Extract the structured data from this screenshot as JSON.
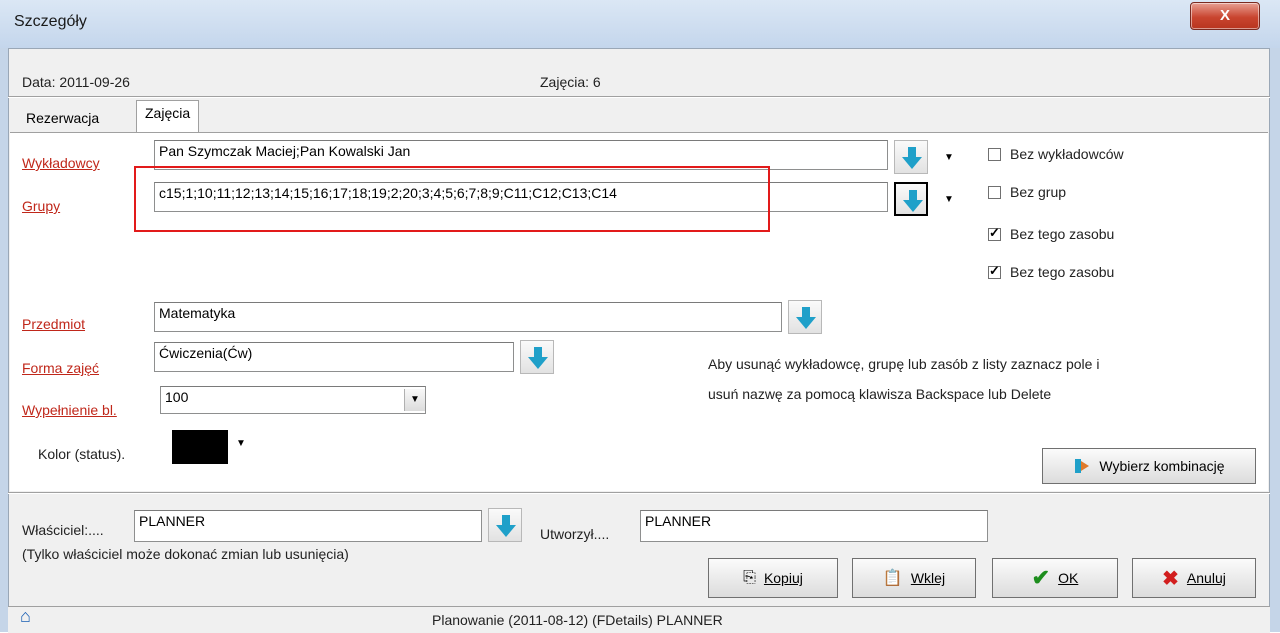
{
  "window": {
    "title": "Szczegóły",
    "close_label": "X"
  },
  "info": {
    "date": "Data:  2011-09-26",
    "lesson": "Zajęcia: 6"
  },
  "tabs": [
    {
      "label": "Rezerwacja"
    },
    {
      "label": "Zajęcia"
    }
  ],
  "form": {
    "lecturers_label": "Wykładowcy",
    "lecturers_value": "Pan Szymczak Maciej;Pan Kowalski Jan",
    "groups_label": "Grupy",
    "groups_value": "c15;1;10;11;12;13;14;15;16;17;18;19;2;20;3;4;5;6;7;8;9;C11;C12;C13;C14",
    "subject_label": "Przedmiot",
    "subject_value": "Matematyka",
    "form_label": "Forma zajęć",
    "form_value": "Ćwiczenia(Ćw)",
    "fill_label": "Wypełnienie bl.",
    "fill_value": "100",
    "color_label": "Kolor (status).",
    "color_value": "#000000"
  },
  "checkboxes": [
    {
      "label": "Bez wykładowców",
      "checked": false
    },
    {
      "label": "Bez grup",
      "checked": false
    },
    {
      "label": "Bez tego zasobu",
      "checked": true
    },
    {
      "label": "Bez tego zasobu",
      "checked": true
    }
  ],
  "hint": {
    "line1": "Aby usunąć wykładowcę, grupę lub zasób z listy zaznacz pole i",
    "line2": "usuń nazwę za pomocą klawisza Backspace lub Delete"
  },
  "combine_button": "Wybierz kombinację",
  "owner": {
    "owner_label": "Właściciel:....",
    "owner_value": "PLANNER",
    "created_label": "Utworzył....",
    "created_value": "PLANNER",
    "note": "(Tylko właściciel może dokonać zmian lub usunięcia)"
  },
  "buttons": {
    "copy": "Kopiuj",
    "paste": "Wklej",
    "ok": "OK",
    "cancel": "Anuluj"
  },
  "status": {
    "text": "Planowanie (2011-08-12) (FDetails)    PLANNER"
  },
  "colors": {
    "accent_red": "#c0271a",
    "highlight": "#e21a1a",
    "arrow": "#1fa0c9"
  }
}
